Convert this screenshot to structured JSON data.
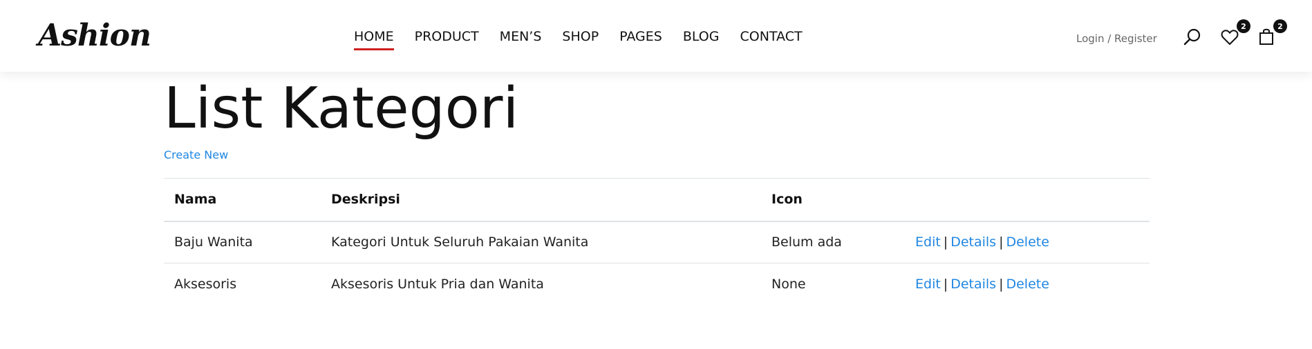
{
  "header": {
    "logo": "Ashion",
    "nav": [
      {
        "label": "HOME",
        "active": true
      },
      {
        "label": "PRODUCT"
      },
      {
        "label": "MEN’S"
      },
      {
        "label": "SHOP"
      },
      {
        "label": "PAGES"
      },
      {
        "label": "BLOG"
      },
      {
        "label": "CONTACT"
      }
    ],
    "login_register": "Login / Register",
    "icons": {
      "search": "search-icon",
      "wishlist": "heart-icon",
      "cart": "shopping-bag-icon"
    },
    "wishlist_count": "2",
    "cart_count": "2",
    "accent_color": "#cf1f1f"
  },
  "page": {
    "title": "List Kategori",
    "create_new": "Create New",
    "link_color": "#1f86e2"
  },
  "table": {
    "columns": [
      "Nama",
      "Deskripsi",
      "Icon",
      ""
    ],
    "rows": [
      {
        "nama": "Baju Wanita",
        "deskripsi": "Kategori Untuk Seluruh Pakaian Wanita",
        "icon": "Belum ada",
        "actions": [
          "Edit",
          "Details",
          "Delete"
        ]
      },
      {
        "nama": "Aksesoris",
        "deskripsi": "Aksesoris Untuk Pria dan Wanita",
        "icon": "None",
        "actions": [
          "Edit",
          "Details",
          "Delete"
        ]
      }
    ],
    "separator": "|"
  }
}
